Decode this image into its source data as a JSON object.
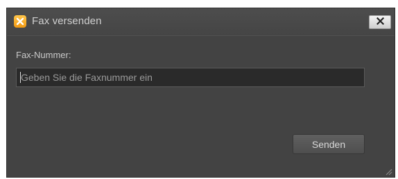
{
  "window": {
    "title": "Fax versenden",
    "close_label": "×"
  },
  "form": {
    "fax_label": "Fax-Nummer:",
    "fax_value": "",
    "fax_placeholder": "Geben Sie die Faxnummer ein",
    "send_label": "Senden"
  },
  "icons": {
    "app": "fax-app-icon",
    "close": "close-icon",
    "resize": "resize-grip-icon"
  },
  "colors": {
    "dialog_bg": "#434343",
    "accent": "#f7a823",
    "input_bg": "#2a2a2a",
    "text": "#c9c9c9"
  }
}
